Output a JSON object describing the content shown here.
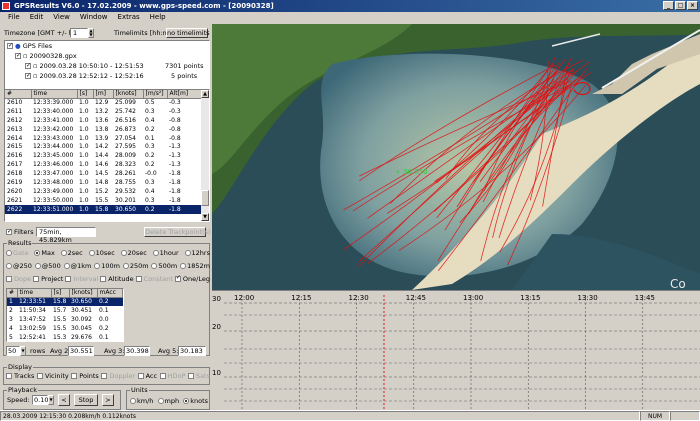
{
  "window": {
    "title": "GPSResults V6.0 - 17.02.2009 - www.gps-speed.com - [20090328]"
  },
  "menu": [
    "File",
    "Edit",
    "View",
    "Window",
    "Extras",
    "Help"
  ],
  "timezone": {
    "label": "Timezone [GMT +/- h]",
    "value": "1"
  },
  "timelimits": {
    "label": "Timelimits [hh:mm]",
    "button": "no timelimits"
  },
  "tree": {
    "root": "GPS Files",
    "file": "20090328.gpx",
    "tracks": [
      {
        "range": "2009.03.28 10:50:10 - 12:51:53",
        "points": "7301 points"
      },
      {
        "range": "2009.03.28 12:52:12 - 12:52:16",
        "points": "5 points"
      }
    ]
  },
  "trackpoints": {
    "headers": [
      "#",
      "time",
      "[s]",
      "[m]",
      "[knots]",
      "[m/s²]",
      "Alt[m]"
    ],
    "rows": [
      [
        "2610",
        "12:33:39.000",
        "1.0",
        "12.9",
        "25.099",
        "0.5",
        "-0.3"
      ],
      [
        "2611",
        "12:33:40.000",
        "1.0",
        "13.2",
        "25.742",
        "0.3",
        "-0.3"
      ],
      [
        "2612",
        "12:33:41.000",
        "1.0",
        "13.6",
        "26.516",
        "0.4",
        "-0.8"
      ],
      [
        "2613",
        "12:33:42.000",
        "1.0",
        "13.8",
        "26.873",
        "0.2",
        "-0.8"
      ],
      [
        "2614",
        "12:33:43.000",
        "1.0",
        "13.9",
        "27.054",
        "0.1",
        "-0.8"
      ],
      [
        "2615",
        "12:33:44.000",
        "1.0",
        "14.2",
        "27.595",
        "0.3",
        "-1.3"
      ],
      [
        "2616",
        "12:33:45.000",
        "1.0",
        "14.4",
        "28.009",
        "0.2",
        "-1.3"
      ],
      [
        "2617",
        "12:33:46.000",
        "1.0",
        "14.6",
        "28.323",
        "0.2",
        "-1.3"
      ],
      [
        "2618",
        "12:33:47.000",
        "1.0",
        "14.5",
        "28.261",
        "-0.0",
        "-1.8"
      ],
      [
        "2619",
        "12:33:48.000",
        "1.0",
        "14.8",
        "28.755",
        "0.3",
        "-1.8"
      ],
      [
        "2620",
        "12:33:49.000",
        "1.0",
        "15.2",
        "29.532",
        "0.4",
        "-1.8"
      ],
      [
        "2621",
        "12:33:50.000",
        "1.0",
        "15.5",
        "30.201",
        "0.3",
        "-1.8"
      ],
      [
        "2622",
        "12:33:51.000",
        "1.0",
        "15.8",
        "30.650",
        "0.2",
        "-1.8"
      ]
    ],
    "selected_index": 12
  },
  "filters": {
    "label": "Filters",
    "value": "75min, 45.829km",
    "delete_button": "Delete Trackpoint(s)"
  },
  "results": {
    "group_label": "Results",
    "row1": [
      "Gate",
      "Max",
      "2sec",
      "10sec",
      "20sec",
      "1hour",
      "12hrs"
    ],
    "row1_selected": "Max",
    "row2": [
      "@250",
      "@500",
      "@1km",
      "100m",
      "250m",
      "500m",
      "1852m"
    ],
    "row3": [
      "Dope",
      "Project",
      "Interval",
      "Altitude",
      "Constant",
      "One/Leg"
    ],
    "headers": [
      "#",
      "time",
      "[s]",
      "[knots]",
      "mAcc"
    ],
    "rows": [
      [
        "1",
        "12:33:51",
        "15.8",
        "30.650",
        "0.2"
      ],
      [
        "2",
        "11:50:34",
        "15.7",
        "30.451",
        "0.1"
      ],
      [
        "3",
        "13:47:52",
        "15.5",
        "30.092",
        "0.0"
      ],
      [
        "4",
        "13:02:59",
        "15.5",
        "30.045",
        "0.2"
      ],
      [
        "5",
        "12:52:41",
        "15.3",
        "29.676",
        "0.1"
      ]
    ],
    "rows_count": "50",
    "rows_label": "rows",
    "avg2_label": "Avg 2:",
    "avg2": "30.551",
    "avg3_label": "Avg 3:",
    "avg3": "30.398",
    "avg5_label": "Avg 5:",
    "avg5": "30.183"
  },
  "display": {
    "label": "Display",
    "items": [
      "Tracks",
      "Vicinity",
      "Points",
      "Doppler",
      "Acc",
      "HDoP",
      "Sats"
    ]
  },
  "playback": {
    "label": "Playback",
    "speed_label": "Speed:",
    "speed": "0.10s",
    "prev": "<",
    "stop": "Stop",
    "next": ">"
  },
  "units": {
    "label": "Units",
    "options": [
      "km/h",
      "mph",
      "knots"
    ],
    "selected": "knots"
  },
  "map": {
    "speed_label": "+ 30.650",
    "watermark": "Co",
    "track_color": "#e01010"
  },
  "chart": {
    "y_ticks": [
      "30",
      "20",
      "10"
    ],
    "x_ticks": [
      "12:00",
      "12:15",
      "12:30",
      "12:45",
      "13:00",
      "13:15",
      "13:30",
      "13:45"
    ],
    "cursor_color": "#d02020"
  },
  "status": {
    "text": "28.03.2009 12:15:30  0.208km/h  0.112knots",
    "num": "NUM"
  }
}
